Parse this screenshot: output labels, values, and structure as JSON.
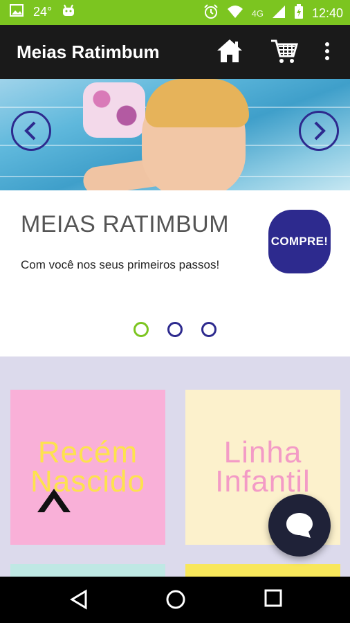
{
  "status_bar": {
    "temperature": "24°",
    "network": "4G",
    "time": "12:40"
  },
  "app_bar": {
    "title": "Meias Ratimbum"
  },
  "banner": {
    "heading": "MEIAS RATIMBUM",
    "subtitle": "Com você nos seus primeiros passos!",
    "cta_label": "COMPRE!",
    "slide_count": 3,
    "active_slide": 1
  },
  "categories": [
    {
      "label_line1": "Recém",
      "label_line2": "Nascido"
    },
    {
      "label_line1": "Linha",
      "label_line2": "Infantil"
    }
  ],
  "colors": {
    "status_bar": "#7cc520",
    "app_bar": "#1a1a1a",
    "accent": "#2d2a8e",
    "category_bg": "#dcdaec"
  }
}
